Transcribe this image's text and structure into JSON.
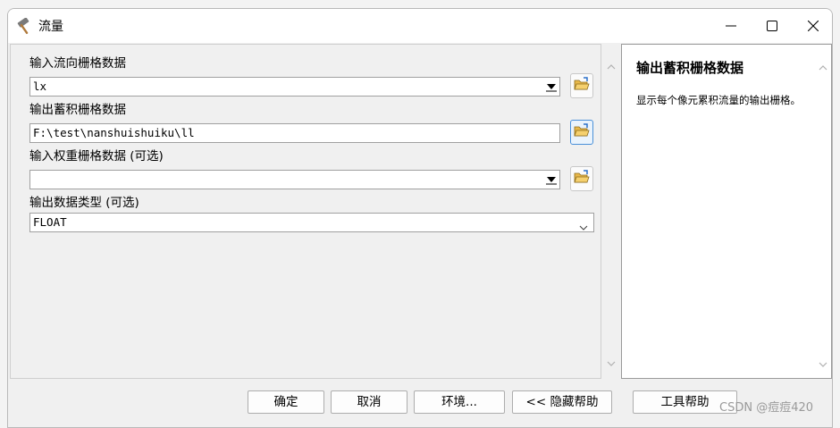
{
  "window": {
    "title": "流量"
  },
  "params": [
    {
      "label": "输入流向栅格数据",
      "value": "lx"
    },
    {
      "label": "输出蓄积栅格数据",
      "value": "F:\\test\\nanshuishuiku\\ll"
    },
    {
      "label": "输入权重栅格数据 (可选)",
      "value": ""
    },
    {
      "label": "输出数据类型 (可选)",
      "value": "FLOAT"
    }
  ],
  "help": {
    "title": "输出蓄积栅格数据",
    "description": "显示每个像元累积流量的输出栅格。"
  },
  "buttons": {
    "ok": "确定",
    "cancel": "取消",
    "environments": "环境...",
    "hide_help": "<< 隐藏帮助",
    "tool_help": "工具帮助"
  },
  "watermark": "CSDN @痘痘420"
}
